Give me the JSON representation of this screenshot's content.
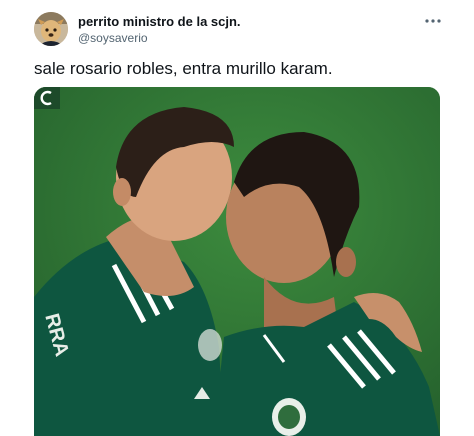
{
  "user": {
    "display_name": "perrito ministro de la scjn.",
    "handle": "@soysaverio",
    "avatar_icon": "avatar-image"
  },
  "more_icon": "more-horizontal-icon",
  "tweet": {
    "text": "sale rosario robles, entra murillo karam."
  },
  "media": {
    "icon": "broadcaster-logo-icon",
    "colors": {
      "pitch": "#2f7d36",
      "jersey": "#0e5640",
      "stripe": "#ffffff"
    }
  }
}
